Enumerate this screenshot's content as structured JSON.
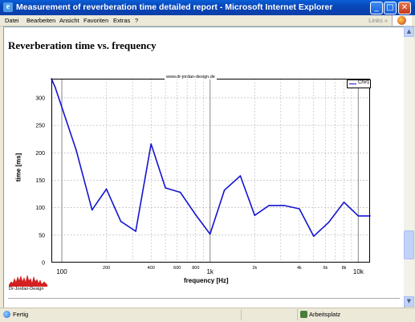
{
  "window": {
    "title": "Measurement of reverberation time detailed report - Microsoft Internet Explorer",
    "minimize": "_",
    "maximize": "□",
    "close": "✕"
  },
  "menu": {
    "items": [
      "Datei",
      "Bearbeiten",
      "Ansicht",
      "Favoriten",
      "Extras",
      "?"
    ],
    "links_label": "Links",
    "links_arrow": "»"
  },
  "page": {
    "heading": "Reverberation time vs. frequency",
    "logo_text": "Dr-Jordan-Design"
  },
  "status": {
    "text": "Fertig",
    "zone": "Arbeitsplatz"
  },
  "scroll": {
    "up": "▲",
    "down": "▼"
  },
  "chart_data": {
    "type": "line",
    "source_label": "www.dr-jordan-design.de",
    "xlabel": "frequency [Hz]",
    "ylabel": "time [ms]",
    "x_scale": "log",
    "xlim": [
      85,
      12000
    ],
    "ylim": [
      0,
      335
    ],
    "grid": true,
    "legend_placement": "top-right",
    "y_ticks": [
      0,
      50,
      100,
      150,
      200,
      250,
      300
    ],
    "x_ticks_major": [
      {
        "value": 100,
        "label": "100"
      },
      {
        "value": 1000,
        "label": "1k"
      },
      {
        "value": 10000,
        "label": "10k"
      }
    ],
    "x_ticks_minor": [
      {
        "value": 200,
        "label": "200"
      },
      {
        "value": 400,
        "label": "400"
      },
      {
        "value": 600,
        "label": "600"
      },
      {
        "value": 800,
        "label": "800"
      },
      {
        "value": 2000,
        "label": "2k"
      },
      {
        "value": 4000,
        "label": "4k"
      },
      {
        "value": 6000,
        "label": "6k"
      },
      {
        "value": 8000,
        "label": "8k"
      }
    ],
    "series": [
      {
        "name": "Ch#1",
        "color": "#1414d2",
        "x": [
          85,
          90,
          125,
          160,
          200,
          250,
          315,
          400,
          500,
          630,
          800,
          1000,
          1250,
          1600,
          2000,
          2500,
          3150,
          4000,
          5000,
          6300,
          8000,
          10000,
          12000
        ],
        "y": [
          335,
          320,
          205,
          96,
          134,
          75,
          57,
          216,
          136,
          128,
          87,
          52,
          132,
          158,
          86,
          104,
          104,
          98,
          48,
          73,
          110,
          85,
          85
        ]
      }
    ]
  }
}
